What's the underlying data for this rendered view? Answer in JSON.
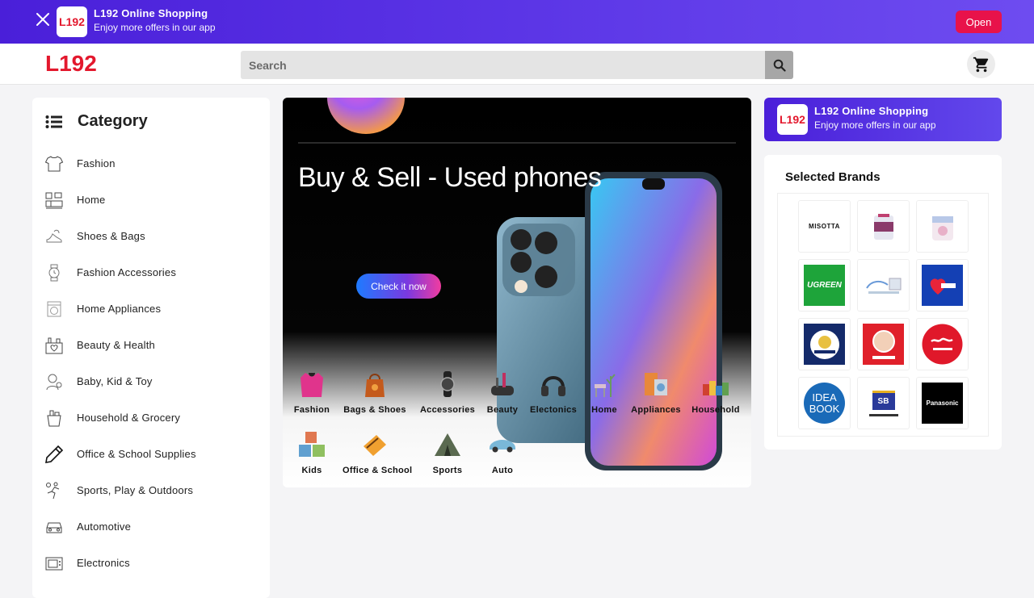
{
  "app_banner": {
    "close_icon": "close-icon",
    "logo_text": "L192",
    "title": "L192 Online Shopping",
    "subtitle": "Enjoy more offers in our app",
    "open_label": "Open"
  },
  "header": {
    "logo": "L192",
    "search_placeholder": "Search",
    "search_icon": "search-icon",
    "cart_icon": "cart-icon"
  },
  "sidebar": {
    "title": "Category",
    "items": [
      {
        "label": "Fashion",
        "icon": "tshirt-icon"
      },
      {
        "label": "Home",
        "icon": "home-furniture-icon"
      },
      {
        "label": "Shoes & Bags",
        "icon": "shoe-bag-icon"
      },
      {
        "label": "Fashion Accessories",
        "icon": "watch-icon"
      },
      {
        "label": "Home Appliances",
        "icon": "washing-machine-icon"
      },
      {
        "label": "Beauty & Health",
        "icon": "beauty-icon"
      },
      {
        "label": "Baby, Kid & Toy",
        "icon": "baby-icon"
      },
      {
        "label": "Household & Grocery",
        "icon": "grocery-icon"
      },
      {
        "label": "Office & School Supplies",
        "icon": "pencil-icon"
      },
      {
        "label": "Sports, Play & Outdoors",
        "icon": "sports-icon"
      },
      {
        "label": "Automotive",
        "icon": "car-icon"
      },
      {
        "label": "Electronics",
        "icon": "electronics-icon"
      }
    ]
  },
  "hero": {
    "headline": "Buy & Sell - Used phones",
    "cta": "Check it now",
    "quick_links": [
      {
        "label": "Fashion",
        "icon": "jacket-icon"
      },
      {
        "label": "Bags & Shoes",
        "icon": "bag-icon"
      },
      {
        "label": "Accessories",
        "icon": "watch-icon"
      },
      {
        "label": "Beauty",
        "icon": "makeup-icon"
      },
      {
        "label": "Electonics",
        "icon": "headphones-icon"
      },
      {
        "label": "Home",
        "icon": "chair-icon"
      },
      {
        "label": "Appliances",
        "icon": "appliance-icon"
      },
      {
        "label": "Household",
        "icon": "household-icon"
      },
      {
        "label": "Kids",
        "icon": "toy-blocks-icon"
      },
      {
        "label": "Office & School",
        "icon": "stationery-icon"
      },
      {
        "label": "Sports",
        "icon": "tent-icon"
      },
      {
        "label": "Auto",
        "icon": "car-icon"
      }
    ]
  },
  "promo": {
    "logo_text": "L192",
    "title": "L192 Online Shopping",
    "subtitle": "Enjoy more offers in our app"
  },
  "brands": {
    "title": "Selected Brands",
    "items": [
      {
        "label": "MISOTTA"
      },
      {
        "label": ""
      },
      {
        "label": ""
      },
      {
        "label": "UGREEN"
      },
      {
        "label": ""
      },
      {
        "label": ""
      },
      {
        "label": ""
      },
      {
        "label": ""
      },
      {
        "label": ""
      },
      {
        "label": "IDEA BOOK"
      },
      {
        "label": "SB"
      },
      {
        "label": "Panasonic"
      }
    ]
  },
  "colors": {
    "brand_red": "#e3182d",
    "banner_purple": "#4a1fd9",
    "open_button": "#e8124a"
  }
}
